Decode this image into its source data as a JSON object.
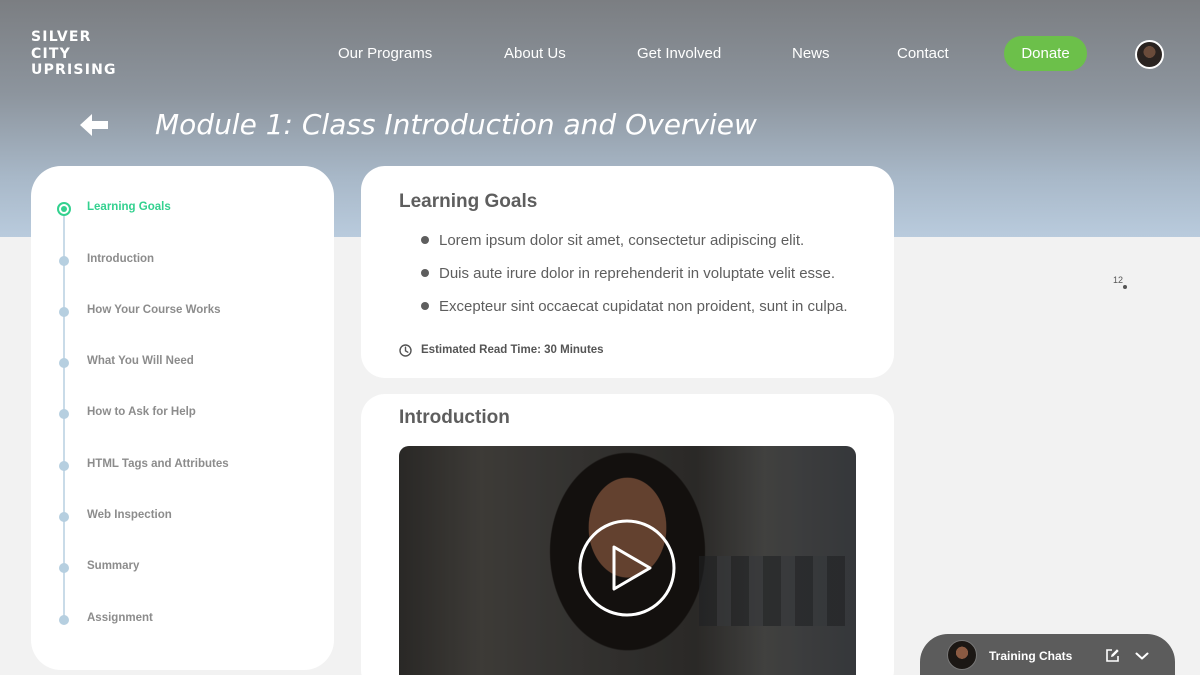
{
  "brand": {
    "logo_lines": [
      "SILVER",
      "CITY",
      "UPRISING"
    ]
  },
  "nav": {
    "links": [
      "Our Programs",
      "About Us",
      "Get Involved",
      "News",
      "Contact"
    ],
    "donate_label": "Donate"
  },
  "page": {
    "title": "Module 1: Class Introduction and Overview"
  },
  "sidebar": {
    "steps": [
      {
        "label": "Learning Goals",
        "active": true
      },
      {
        "label": "Introduction",
        "active": false
      },
      {
        "label": "How Your Course Works",
        "active": false
      },
      {
        "label": "What You Will Need",
        "active": false
      },
      {
        "label": "How to Ask for Help",
        "active": false
      },
      {
        "label": "HTML Tags and Attributes",
        "active": false
      },
      {
        "label": "Web Inspection",
        "active": false
      },
      {
        "label": "Summary",
        "active": false
      },
      {
        "label": "Assignment",
        "active": false
      }
    ]
  },
  "goals": {
    "title": "Learning Goals",
    "items": [
      "Lorem ipsum dolor sit amet, consectetur adipiscing elit.",
      "Duis aute irure dolor in reprehenderit in voluptate velit esse.",
      "Excepteur sint occaecat cupidatat non proident, sunt in culpa."
    ],
    "read_time": "Estimated Read Time: 30 Minutes"
  },
  "intro": {
    "title": "Introduction"
  },
  "marker": {
    "label": "12"
  },
  "chat": {
    "label": "Training Chats"
  },
  "colors": {
    "accent_green": "#33d18f",
    "donate_green": "#6cc04a",
    "text_gray": "#5e5e5e"
  },
  "icons": [
    "back-arrow-icon",
    "clock-icon",
    "play-icon",
    "compose-icon",
    "chevron-down-icon"
  ]
}
